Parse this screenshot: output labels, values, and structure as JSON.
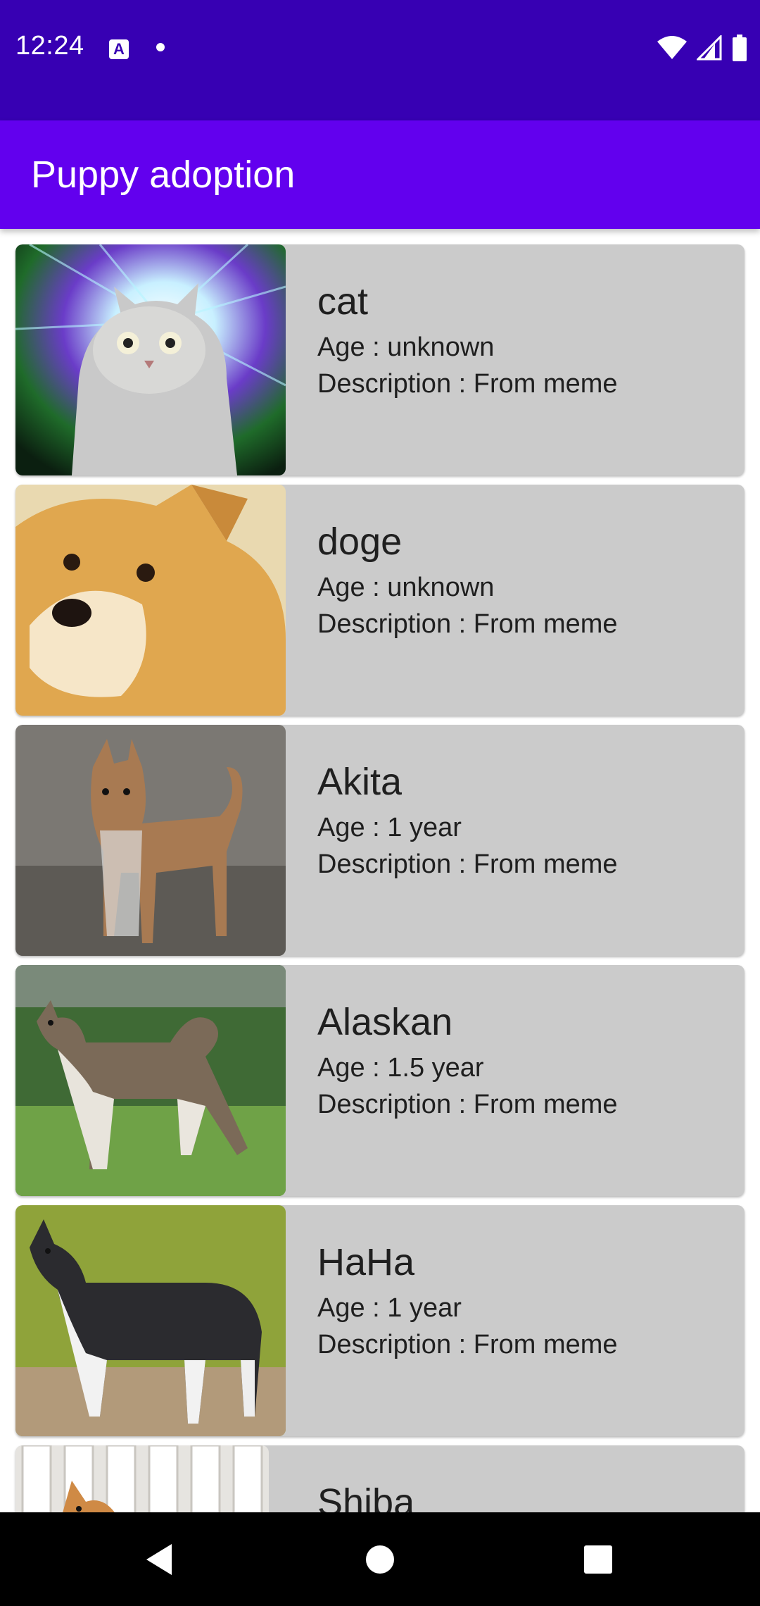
{
  "status_bar": {
    "time": "12:24",
    "notification_icon": "A"
  },
  "app_bar": {
    "title": "Puppy adoption"
  },
  "pets": [
    {
      "name": "cat",
      "age": "Age : unknown",
      "description": "Description : From meme",
      "photo": "cat-meme-photo"
    },
    {
      "name": "doge",
      "age": "Age : unknown",
      "description": "Description : From meme",
      "photo": "doge-meme-photo"
    },
    {
      "name": "Akita",
      "age": "Age : 1 year",
      "description": "Description : From meme",
      "photo": "akita-photo"
    },
    {
      "name": "Alaskan",
      "age": "Age : 1.5 year",
      "description": "Description : From meme",
      "photo": "alaskan-photo"
    },
    {
      "name": "HaHa",
      "age": "Age : 1 year",
      "description": "Description : From meme",
      "photo": "husky-photo"
    },
    {
      "name": "Shiba",
      "photo": "shiba-photo"
    }
  ],
  "colors": {
    "status_bar": "#3700B3",
    "app_bar": "#6200EE",
    "card_background": "#CBCBCB",
    "nav_bar": "#000000"
  },
  "icons": {
    "back": "back-triangle-icon",
    "home": "home-circle-icon",
    "recents": "recents-square-icon"
  }
}
